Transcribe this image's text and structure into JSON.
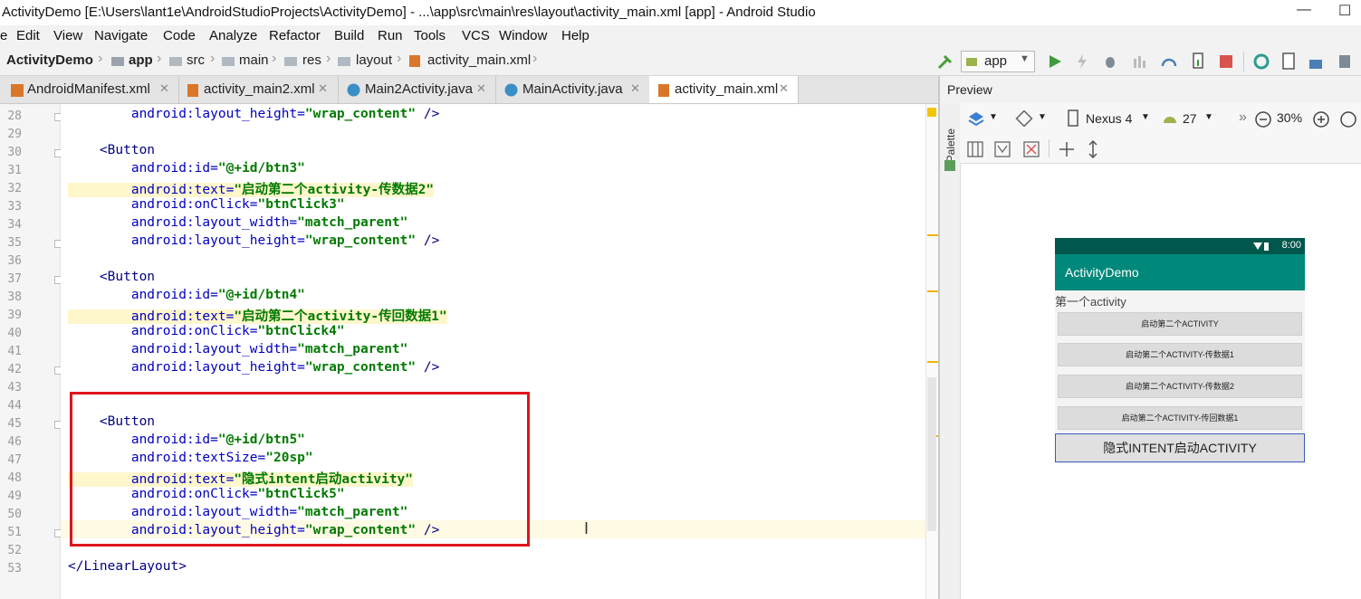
{
  "window": {
    "title": "ActivityDemo [E:\\Users\\lant1e\\AndroidStudioProjects\\ActivityDemo] - ...\\app\\src\\main\\res\\layout\\activity_main.xml [app] - Android Studio",
    "minimize": "—",
    "maximize": "☐"
  },
  "menu": [
    "e",
    "Edit",
    "View",
    "Navigate",
    "Code",
    "Analyze",
    "Refactor",
    "Build",
    "Run",
    "Tools",
    "VCS",
    "Window",
    "Help"
  ],
  "breadcrumb": [
    "ActivityDemo",
    "app",
    "src",
    "main",
    "res",
    "layout",
    "activity_main.xml"
  ],
  "toolbar": {
    "run_config": "app"
  },
  "tabs": [
    {
      "label": "AndroidManifest.xml",
      "active": false
    },
    {
      "label": "activity_main2.xml",
      "active": false
    },
    {
      "label": "Main2Activity.java",
      "active": false
    },
    {
      "label": "MainActivity.java",
      "active": false
    },
    {
      "label": "activity_main.xml",
      "active": true
    }
  ],
  "editor": {
    "lines": [
      {
        "n": "28",
        "parts": [
          [
            "attr",
            "        android:layout_height="
          ],
          [
            "val",
            "\"wrap_content\""
          ],
          [
            "tag",
            " />"
          ]
        ]
      },
      {
        "n": "29",
        "parts": []
      },
      {
        "n": "30",
        "parts": [
          [
            "tag",
            "    <Button"
          ]
        ]
      },
      {
        "n": "31",
        "parts": [
          [
            "attr",
            "        android:id="
          ],
          [
            "val",
            "\"@+id/btn3\""
          ]
        ]
      },
      {
        "n": "32",
        "parts": [
          [
            "attrhl",
            "        android:text="
          ],
          [
            "valhl",
            "\"启动第二个activity-传数据2\""
          ]
        ]
      },
      {
        "n": "33",
        "parts": [
          [
            "attr",
            "        android:onClick="
          ],
          [
            "val",
            "\"btnClick3\""
          ]
        ]
      },
      {
        "n": "34",
        "parts": [
          [
            "attr",
            "        android:layout_width="
          ],
          [
            "val",
            "\"match_parent\""
          ]
        ]
      },
      {
        "n": "35",
        "parts": [
          [
            "attr",
            "        android:layout_height="
          ],
          [
            "val",
            "\"wrap_content\""
          ],
          [
            "tag",
            " />"
          ]
        ]
      },
      {
        "n": "36",
        "parts": []
      },
      {
        "n": "37",
        "parts": [
          [
            "tag",
            "    <Button"
          ]
        ]
      },
      {
        "n": "38",
        "parts": [
          [
            "attr",
            "        android:id="
          ],
          [
            "val",
            "\"@+id/btn4\""
          ]
        ]
      },
      {
        "n": "39",
        "parts": [
          [
            "attrhl",
            "        android:text="
          ],
          [
            "valhl",
            "\"启动第二个activity-传回数据1\""
          ]
        ]
      },
      {
        "n": "40",
        "parts": [
          [
            "attr",
            "        android:onClick="
          ],
          [
            "val",
            "\"btnClick4\""
          ]
        ]
      },
      {
        "n": "41",
        "parts": [
          [
            "attr",
            "        android:layout_width="
          ],
          [
            "val",
            "\"match_parent\""
          ]
        ]
      },
      {
        "n": "42",
        "parts": [
          [
            "attr",
            "        android:layout_height="
          ],
          [
            "val",
            "\"wrap_content\""
          ],
          [
            "tag",
            " />"
          ]
        ]
      },
      {
        "n": "43",
        "parts": []
      },
      {
        "n": "44",
        "parts": []
      },
      {
        "n": "45",
        "parts": [
          [
            "tag",
            "    <Button"
          ]
        ]
      },
      {
        "n": "46",
        "parts": [
          [
            "attr",
            "        android:id="
          ],
          [
            "val",
            "\"@+id/btn5\""
          ]
        ]
      },
      {
        "n": "47",
        "parts": [
          [
            "attr",
            "        android:textSize="
          ],
          [
            "val",
            "\"20sp\""
          ]
        ]
      },
      {
        "n": "48",
        "parts": [
          [
            "attrhl",
            "        android:text="
          ],
          [
            "valhl",
            "\"隐式intent启动activity\""
          ]
        ]
      },
      {
        "n": "49",
        "parts": [
          [
            "attr",
            "        android:onClick="
          ],
          [
            "val",
            "\"btnClick5\""
          ]
        ]
      },
      {
        "n": "50",
        "parts": [
          [
            "attr",
            "        android:layout_width="
          ],
          [
            "val",
            "\"match_parent\""
          ]
        ]
      },
      {
        "n": "51",
        "parts": [
          [
            "attr",
            "        android:layout_height="
          ],
          [
            "val",
            "\"wrap_content\""
          ],
          [
            "tag",
            " />"
          ]
        ]
      },
      {
        "n": "52",
        "parts": []
      },
      {
        "n": "53",
        "parts": [
          [
            "tag",
            "</LinearLayout>"
          ]
        ]
      }
    ]
  },
  "preview": {
    "header": "Preview",
    "palette_label": "Palette",
    "device": "Nexus 4",
    "api": "27",
    "zoom": "30%",
    "phone": {
      "time": "8:00",
      "app_title": "ActivityDemo",
      "subtitle": "第一个activity",
      "buttons": [
        "启动第二个ACTIVITY",
        "启动第二个ACTIVITY-传数据1",
        "启动第二个ACTIVITY-传数据2",
        "启动第二个ACTIVITY-传回数据1",
        "隐式INTENT启动ACTIVITY"
      ]
    }
  },
  "colors": {
    "accent_red": "#e0141c",
    "app_bar": "#00897b",
    "status_bar": "#00574b"
  }
}
